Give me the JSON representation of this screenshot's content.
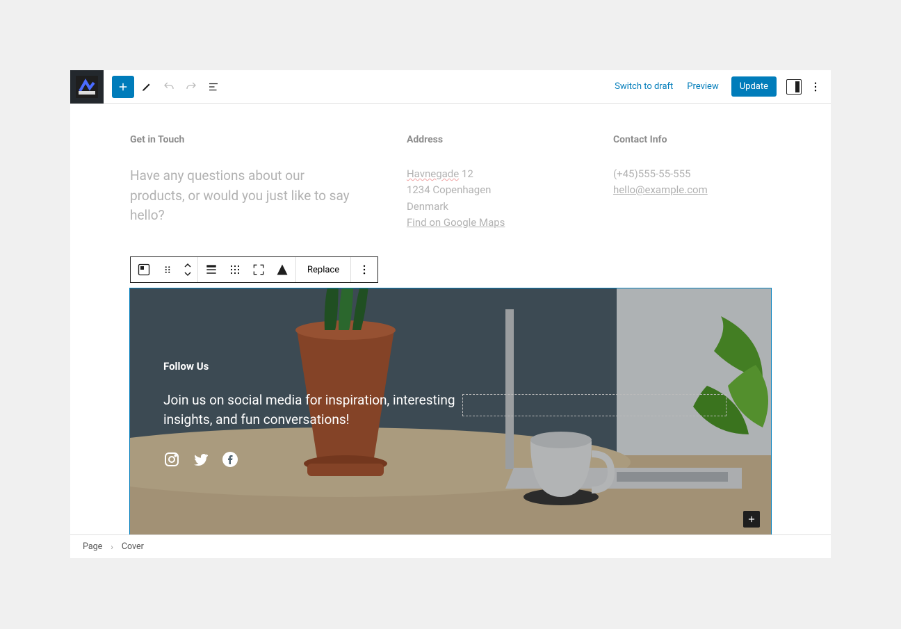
{
  "topbar": {
    "switch_draft": "Switch to draft",
    "preview": "Preview",
    "update": "Update"
  },
  "info": {
    "touch": {
      "heading": "Get in Touch",
      "lead": "Have any questions about our products, or would you just like to say hello?"
    },
    "address": {
      "heading": "Address",
      "line1_wavy": "Havnegade",
      "line1_rest": " 12",
      "line2": "1234 Copenhagen",
      "line3": "Denmark",
      "maplink": "Find on Google Maps"
    },
    "contact": {
      "heading": "Contact Info",
      "phone": "(+45)555-55-555",
      "email": "hello@example.com"
    }
  },
  "block_toolbar": {
    "replace": "Replace"
  },
  "cover": {
    "heading": "Follow Us",
    "paragraph": "Join us on social media for inspiration, interesting insights, and fun conversations!",
    "social": [
      "instagram",
      "twitter",
      "facebook"
    ]
  },
  "breadcrumb": {
    "root": "Page",
    "current": "Cover"
  }
}
